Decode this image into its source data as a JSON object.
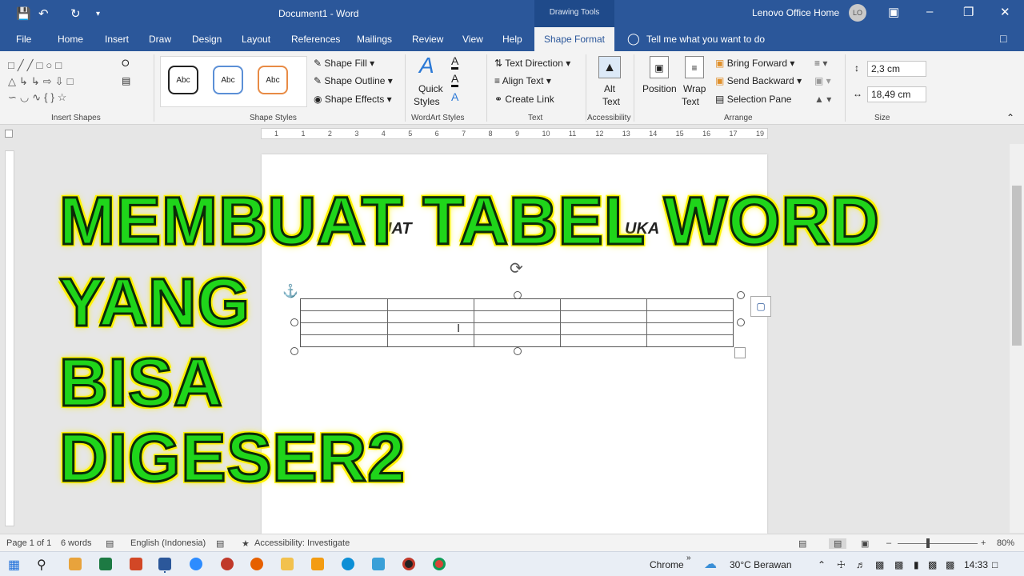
{
  "titlebar": {
    "doc_title": "Document1  -  Word",
    "contextual": "Drawing Tools",
    "account": "Lenovo Office Home",
    "avatar": "LO"
  },
  "tabs": [
    "File",
    "Home",
    "Insert",
    "Draw",
    "Design",
    "Layout",
    "References",
    "Mailings",
    "Review",
    "View",
    "Help"
  ],
  "active_tab": "Shape Format",
  "tell_me": "Tell me what you want to do",
  "ribbon": {
    "insert_shapes": "Insert Shapes",
    "shape_styles_label": "Shape Styles",
    "abc": "Abc",
    "shape_fill": "Shape Fill",
    "shape_outline": "Shape Outline",
    "shape_effects": "Shape Effects",
    "quick_styles_1": "Quick",
    "quick_styles_2": "Styles",
    "wordart_label": "WordArt Styles",
    "text_direction": "Text Direction",
    "align_text": "Align Text",
    "create_link": "Create Link",
    "text_label": "Text",
    "alt_text_1": "Alt",
    "alt_text_2": "Text",
    "accessibility_label": "Accessibility",
    "position": "Position",
    "wrap_text_1": "Wrap",
    "wrap_text_2": "Text",
    "bring_forward": "Bring Forward",
    "send_backward": "Send Backward",
    "selection_pane": "Selection Pane",
    "arrange_label": "Arrange",
    "height": "2,3 cm",
    "width": "18,49 cm",
    "size_label": "Size"
  },
  "ruler_numbers": [
    "1",
    "1",
    "2",
    "3",
    "4",
    "5",
    "6",
    "7",
    "8",
    "9",
    "10",
    "11",
    "12",
    "13",
    "14",
    "15",
    "16",
    "17",
    "19"
  ],
  "page_text_left": "UAT",
  "page_text_right": "UKA",
  "overlay": {
    "line1": "MEMBUAT TABEL WORD",
    "line2": "YANG",
    "line3": "BISA",
    "line4": "DIGESER2"
  },
  "status": {
    "page": "Page 1 of 1",
    "words": "6 words",
    "language": "English (Indonesia)",
    "accessibility": "Accessibility: Investigate",
    "zoom": "80%"
  },
  "taskbar": {
    "chrome": "Chrome",
    "weather": "30°C  Berawan",
    "time": "14:33"
  },
  "colors": {
    "word_blue": "#2b579a",
    "overlay_green": "#1fd51a",
    "overlay_yellow": "#fff200"
  }
}
